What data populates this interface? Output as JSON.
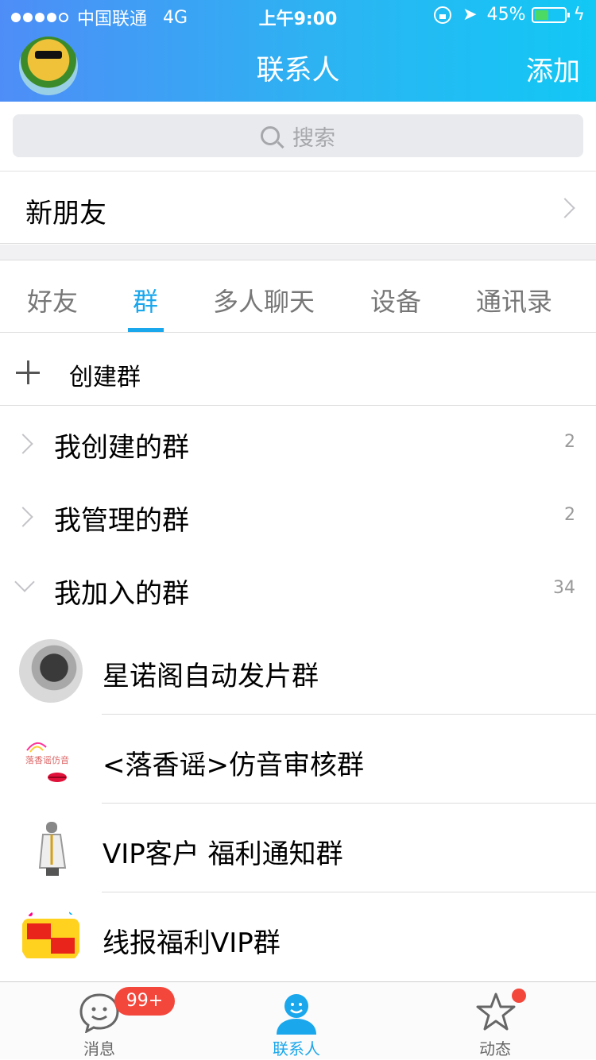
{
  "status_bar": {
    "carrier": "中国联通",
    "network": "4G",
    "time": "上午9:00",
    "battery_text": "45%",
    "battery_level": 0.45,
    "battery_color": "#4cd964"
  },
  "header": {
    "title": "联系人",
    "add_label": "添加",
    "gradient": [
      "#4e8df7",
      "#12c8f5"
    ]
  },
  "search": {
    "placeholder": "搜索"
  },
  "new_friend": {
    "label": "新朋友"
  },
  "tabs": [
    {
      "label": "好友",
      "active": false
    },
    {
      "label": "群",
      "active": true
    },
    {
      "label": "多人聊天",
      "active": false
    },
    {
      "label": "设备",
      "active": false
    },
    {
      "label": "通讯录",
      "active": false
    }
  ],
  "accent_color": "#1aa7ec",
  "create_group": {
    "label": "创建群"
  },
  "group_sections": [
    {
      "label": "我创建的群",
      "count": "2",
      "expanded": false
    },
    {
      "label": "我管理的群",
      "count": "2",
      "expanded": false
    },
    {
      "label": "我加入的群",
      "count": "34",
      "expanded": true
    }
  ],
  "groups": [
    {
      "name": "星诺阁自动发片群",
      "avatar_icon": "portrait-photo-icon"
    },
    {
      "name": "<落香谣>仿音审核群",
      "avatar_icon": "lips-logo-icon"
    },
    {
      "name": "VIP客户 福利通知群",
      "avatar_icon": "suit-figure-icon"
    },
    {
      "name": "线报福利VIP群",
      "avatar_icon": "flash-sale-logo-icon"
    }
  ],
  "tab_bar": {
    "messages": {
      "label": "消息",
      "badge": "99+"
    },
    "contacts": {
      "label": "联系人",
      "active": true
    },
    "moments": {
      "label": "动态",
      "has_dot": true
    }
  }
}
